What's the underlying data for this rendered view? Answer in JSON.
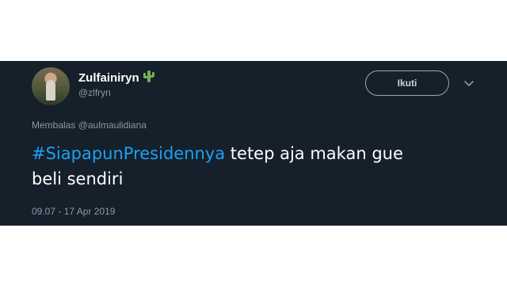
{
  "tweet": {
    "author": {
      "display_name": "Zulfainiryn",
      "emoji_icon": "cactus-icon",
      "handle": "@zlfryn",
      "avatar": "profile-photo"
    },
    "follow_label": "Ikuti",
    "menu_icon": "chevron-down-icon",
    "reply_prefix": "Membalas",
    "reply_to": "@aulmaulidiana",
    "hashtag": "#SiapapunPresidennya",
    "text_line1": " tetep aja makan gue",
    "text_line2": "beli sendiri",
    "timestamp": "09.07 - 17 Apr 2019"
  },
  "colors": {
    "card_background": "#15202b",
    "hashtag": "#1da1f2",
    "secondary_text": "#8899a6",
    "primary_text": "#ffffff",
    "emoji": "#77b255"
  }
}
